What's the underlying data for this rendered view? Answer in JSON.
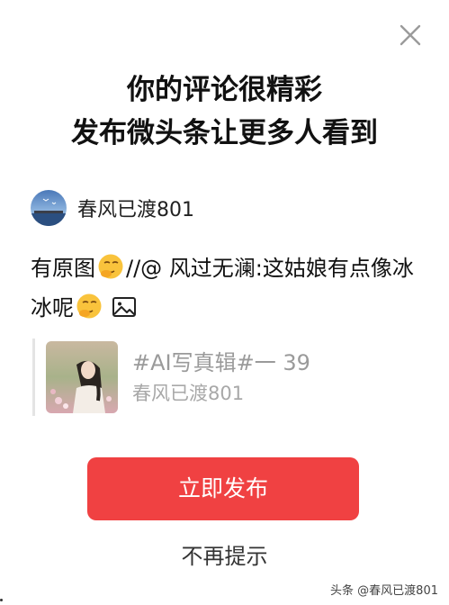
{
  "dialog": {
    "title_line1": "你的评论很精彩",
    "title_line2": "发布微头条让更多人看到",
    "author": {
      "name": "春风已渡801"
    },
    "comment": {
      "part1": "有原图",
      "part2": "//@",
      "part3": "风过无澜:这姑娘有点像冰冰呢"
    },
    "quote": {
      "title": "#AI写真辑#一 39",
      "author": "春风已渡801"
    },
    "publish_label": "立即发布",
    "dismiss_label": "不再提示"
  },
  "watermark": "头条 @春风已渡801",
  "colors": {
    "accent": "#f04142",
    "muted_text": "#9a9a9a"
  },
  "icons": [
    "close-icon",
    "smirk-emoji-icon",
    "image-icon"
  ]
}
